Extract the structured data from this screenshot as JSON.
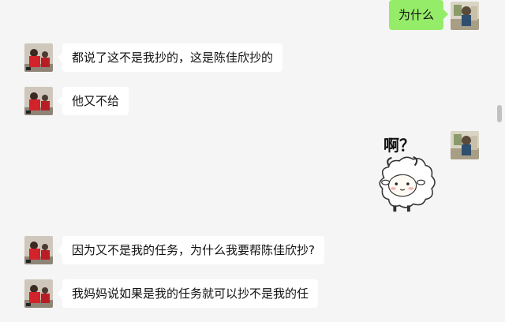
{
  "colors": {
    "background": "#f5f5f5",
    "incoming_bubble": "#ffffff",
    "outgoing_bubble": "#95ec69"
  },
  "messages": [
    {
      "side": "outgoing",
      "type": "text",
      "text": "为什么",
      "avatar": "self-avatar"
    },
    {
      "side": "incoming",
      "type": "text",
      "text": "都说了这不是我抄的，这是陈佳欣抄的",
      "avatar": "contact-avatar"
    },
    {
      "side": "incoming",
      "type": "text",
      "text": "他又不给",
      "avatar": "contact-avatar"
    },
    {
      "side": "outgoing",
      "type": "sticker",
      "text": "啊？",
      "icon": "sheep-sticker-icon",
      "avatar": "self-avatar"
    },
    {
      "side": "incoming",
      "type": "text",
      "text": "因为又不是我的任务，为什么我要帮陈佳欣抄?",
      "avatar": "contact-avatar"
    },
    {
      "side": "incoming",
      "type": "text",
      "text": "我妈妈说如果是我的任务就可以抄不是我的任",
      "avatar": "contact-avatar"
    }
  ]
}
